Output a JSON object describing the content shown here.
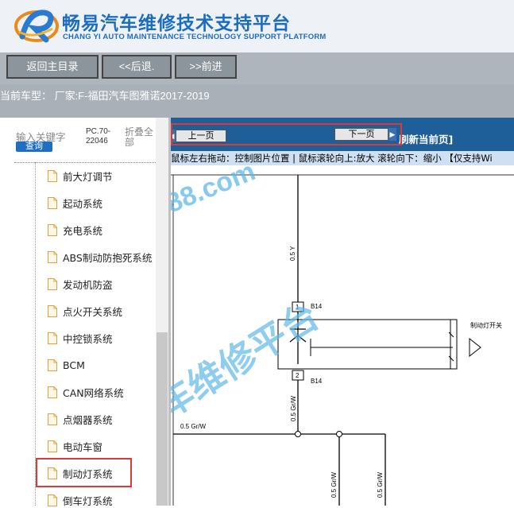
{
  "header": {
    "title": "畅易汽车维修技术支持平台",
    "subtitle": "CHANG YI AUTO MAINTENANCE TECHNOLOGY SUPPORT PLATFORM",
    "brand_color": "#1c6dbf"
  },
  "nav": {
    "home_label": "返回主目录",
    "back_label": "<<后退.",
    "forward_label": ">>前进"
  },
  "car_info": "当前车型： 厂家:F-福田汽车图雅诺2017-2019",
  "sidebar": {
    "search_placeholder": "输入关键字",
    "search_button": "查询",
    "pc_code_line1": "PC.70-",
    "pc_code_line2": "22046",
    "fold_label": "折叠全部",
    "items": [
      {
        "label": "前大灯调节"
      },
      {
        "label": "起动系统"
      },
      {
        "label": "充电系统"
      },
      {
        "label": "ABS制动防抱死系统"
      },
      {
        "label": "发动机防盗"
      },
      {
        "label": "点火开关系统"
      },
      {
        "label": "中控锁系统"
      },
      {
        "label": "BCM"
      },
      {
        "label": "CAN网络系统"
      },
      {
        "label": "点烟器系统"
      },
      {
        "label": "电动车窗"
      },
      {
        "label": "制动灯系统"
      },
      {
        "label": "倒车灯系统"
      }
    ],
    "selected_item": "制动灯系统"
  },
  "viewer": {
    "prev_page": "上一页",
    "next_page": "下一页",
    "refresh": "刷新当前页]",
    "hint": "鼠标左右拖动：控制图片位置 | 鼠标滚轮向上:放大 滚轮向下：缩小 【仅支持Wi"
  },
  "diagram": {
    "wire_05y": "0.5 Y",
    "connector_b14_top": "B14",
    "connector_b14_bottom": "B14",
    "pin_top": "1",
    "pin_bottom": "2",
    "switch_label": "制动灯开关",
    "wire_05grw_vertical": "0.5 Gr/W",
    "wire_05grw_horizontal": "0.5 Gr/W",
    "wire_05grw_bottom1": "0.5 Gr/W",
    "wire_05grw_bottom2": "0.5 Gr/W",
    "watermark_1": "88.com",
    "watermark_2": "车维修平台"
  }
}
